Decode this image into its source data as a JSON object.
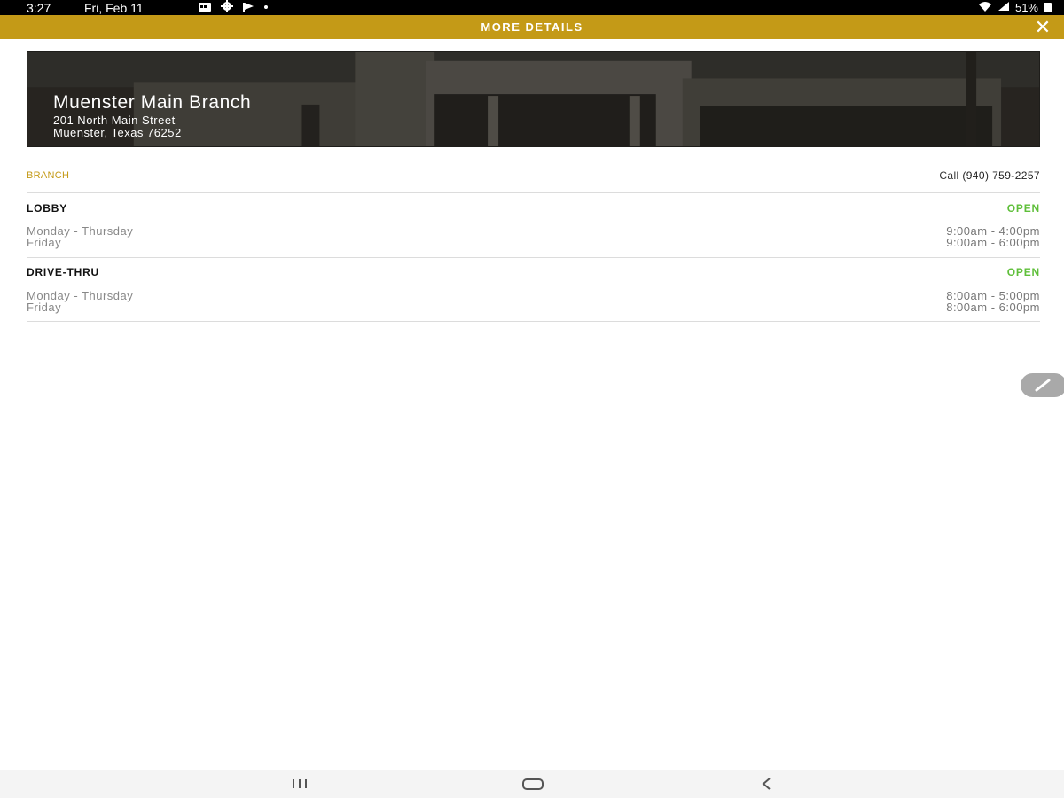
{
  "status_bar": {
    "time": "3:27",
    "date": "Fri, Feb 11",
    "battery": "51%",
    "icons": [
      "calendar-icon",
      "settings-icon",
      "flag-icon",
      "dot-icon",
      "wifi-icon",
      "signal-icon",
      "battery-icon"
    ]
  },
  "header": {
    "title": "MORE DETAILS",
    "close_icon": "close-icon"
  },
  "banner": {
    "branch_name": "Muenster Main Branch",
    "address_line1": "201 North Main Street",
    "address_line2": "Muenster, Texas 76252"
  },
  "info": {
    "branch_label": "BRANCH",
    "call_prefix": "Call",
    "phone": "(940) 759-2257"
  },
  "lobby": {
    "title": "LOBBY",
    "status": "OPEN",
    "rows": [
      {
        "day": "Monday - Thursday",
        "hours": "9:00am - 4:00pm"
      },
      {
        "day": "Friday",
        "hours": "9:00am - 6:00pm"
      }
    ]
  },
  "drive_thru": {
    "title": "DRIVE-THRU",
    "status": "OPEN",
    "rows": [
      {
        "day": "Monday - Thursday",
        "hours": "8:00am - 5:00pm"
      },
      {
        "day": "Friday",
        "hours": "8:00am - 6:00pm"
      }
    ]
  },
  "colors": {
    "accent": "#c49a17",
    "open": "#5fbf3a",
    "status_bar": "#000000"
  },
  "nav": {
    "icons": [
      "recent-apps-icon",
      "home-icon",
      "back-icon"
    ]
  }
}
